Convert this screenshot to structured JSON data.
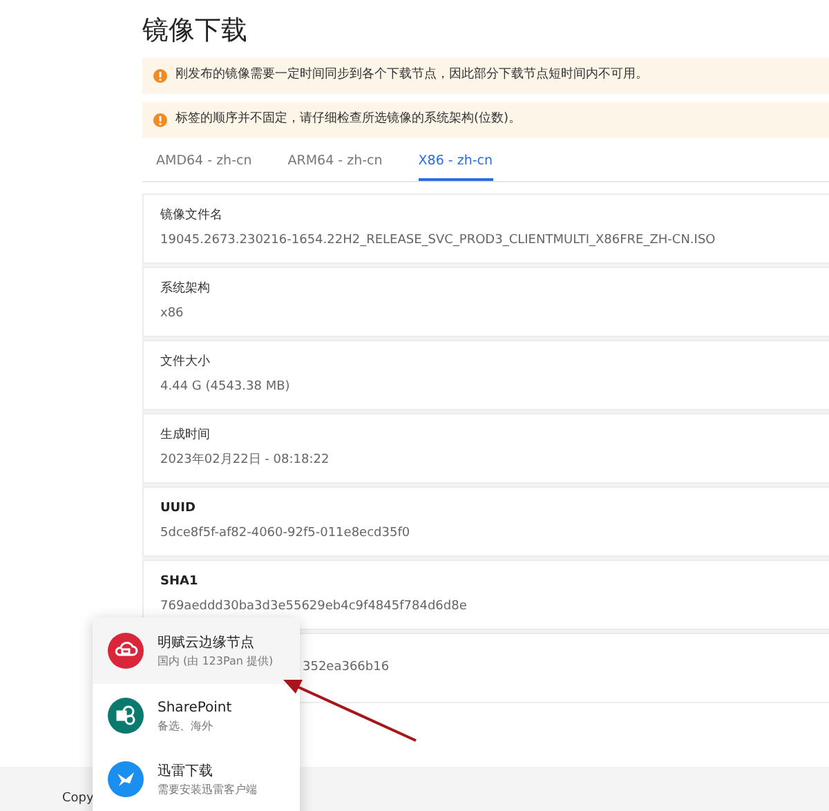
{
  "title": "镜像下载",
  "alerts": [
    "刚发布的镜像需要一定时间同步到各个下载节点，因此部分下载节点短时间内不可用。",
    "标签的顺序并不固定，请仔细检查所选镜像的系统架构(位数)。"
  ],
  "tabs": [
    {
      "label": "AMD64 - zh-cn",
      "selected": false
    },
    {
      "label": "ARM64 - zh-cn",
      "selected": false
    },
    {
      "label": "X86 - zh-cn",
      "selected": true
    }
  ],
  "details": [
    {
      "label": "镜像文件名",
      "value": "19045.2673.230216-1654.22H2_RELEASE_SVC_PROD3_CLIENTMULTI_X86FRE_ZH-CN.ISO",
      "bold": false
    },
    {
      "label": "系统架构",
      "value": "x86",
      "bold": false
    },
    {
      "label": "文件大小",
      "value": "4.44 G (4543.38 MB)",
      "bold": false
    },
    {
      "label": "生成时间",
      "value": "2023年02月22日 - 08:18:22",
      "bold": false
    },
    {
      "label": "UUID",
      "value": "5dce8f5f-af82-4060-92f5-011e8ecd35f0",
      "bold": true
    },
    {
      "label": "SHA1",
      "value": "769aeddd30ba3d3e55629eb4c9f4845f784d6d8e",
      "bold": true
    },
    {
      "value": "352ea366b16"
    }
  ],
  "footer": "Copy",
  "menu": [
    {
      "kind": "cloud",
      "name": "明赋云边缘节点",
      "note": "国内 (由 123Pan 提供)",
      "color": "#d9263a",
      "selected": true
    },
    {
      "kind": "share",
      "name": "SharePoint",
      "note": "备选、海外",
      "color": "#0b7a6e",
      "selected": false
    },
    {
      "kind": "bird",
      "name": "迅雷下载",
      "note": "需要安装迅雷客户端",
      "color": "#1a8ff0",
      "selected": false
    }
  ]
}
